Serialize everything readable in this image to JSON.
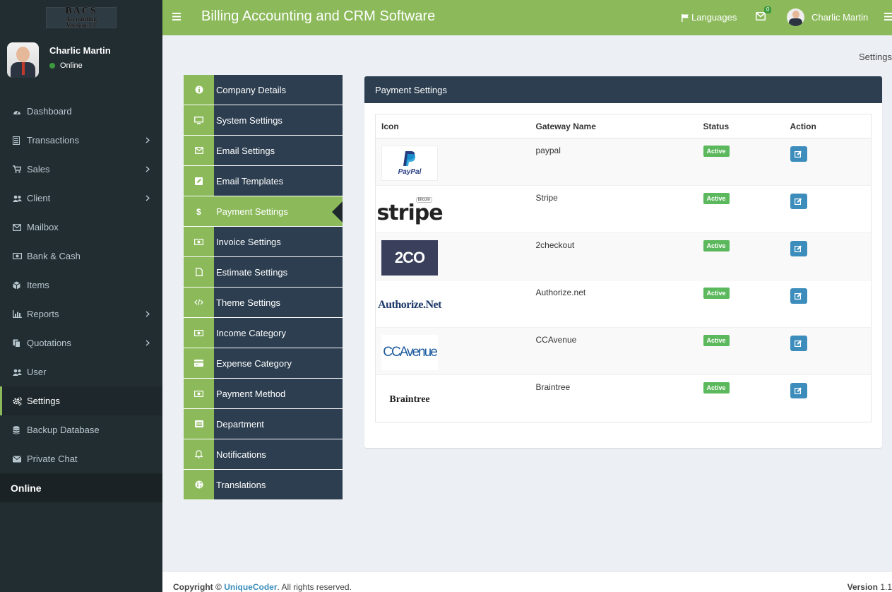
{
  "logo": {
    "line1": "BACS",
    "line2": "Accounting",
    "line3": "Version 1.1"
  },
  "user": {
    "name": "Charlic Martin",
    "status": "Online"
  },
  "sidebar": {
    "items": [
      {
        "label": "Dashboard",
        "icon": "dashboard-icon",
        "chevron": false
      },
      {
        "label": "Transactions",
        "icon": "transactions-icon",
        "chevron": true
      },
      {
        "label": "Sales",
        "icon": "cart-icon",
        "chevron": true
      },
      {
        "label": "Client",
        "icon": "users-icon",
        "chevron": true
      },
      {
        "label": "Mailbox",
        "icon": "mail-icon",
        "chevron": false
      },
      {
        "label": "Bank & Cash",
        "icon": "money-icon",
        "chevron": false
      },
      {
        "label": "Items",
        "icon": "cube-icon",
        "chevron": false
      },
      {
        "label": "Reports",
        "icon": "chart-icon",
        "chevron": true
      },
      {
        "label": "Quotations",
        "icon": "copy-icon",
        "chevron": true
      },
      {
        "label": "User",
        "icon": "users-icon",
        "chevron": false
      },
      {
        "label": "Settings",
        "icon": "gears-icon",
        "chevron": false,
        "active": true
      },
      {
        "label": "Backup Database",
        "icon": "database-icon",
        "chevron": false
      },
      {
        "label": "Private Chat",
        "icon": "envelope-icon",
        "chevron": false
      }
    ],
    "online_heading": "Online"
  },
  "header": {
    "title": "Billing Accounting and CRM Software",
    "languages": "Languages",
    "mail_count": "0",
    "user_name": "Charlic Martin"
  },
  "breadcrumb": "Settings",
  "settings_menu": [
    {
      "label": "Company Details",
      "icon": "info-icon"
    },
    {
      "label": "System Settings",
      "icon": "desktop-icon"
    },
    {
      "label": "Email Settings",
      "icon": "envelope-icon"
    },
    {
      "label": "Email Templates",
      "icon": "edit-icon"
    },
    {
      "label": "Payment Settings",
      "icon": "dollar-icon",
      "active": true
    },
    {
      "label": "Invoice Settings",
      "icon": "money-icon"
    },
    {
      "label": "Estimate Settings",
      "icon": "file-icon"
    },
    {
      "label": "Theme Settings",
      "icon": "code-icon"
    },
    {
      "label": "Income Category",
      "icon": "money-icon"
    },
    {
      "label": "Expense Category",
      "icon": "card-icon"
    },
    {
      "label": "Payment Method",
      "icon": "money-icon"
    },
    {
      "label": "Department",
      "icon": "list-icon"
    },
    {
      "label": "Notifications",
      "icon": "bell-icon"
    },
    {
      "label": "Translations",
      "icon": "globe-icon"
    }
  ],
  "payment_panel": {
    "title": "Payment Settings",
    "columns": [
      "Icon",
      "Gateway Name",
      "Status",
      "Action"
    ],
    "rows": [
      {
        "gateway": "paypal",
        "status": "Active",
        "logo_text": "PayPal",
        "logo": "paypal-logo"
      },
      {
        "gateway": "Stripe",
        "status": "Active",
        "logo_text": "stripe",
        "logo_sub": "bitcoin",
        "logo": "stripe-logo"
      },
      {
        "gateway": "2checkout",
        "status": "Active",
        "logo_text": "2CO",
        "logo": "2co-logo"
      },
      {
        "gateway": "Authorize.net",
        "status": "Active",
        "logo_text": "Authorize.Net",
        "logo": "authorizenet-logo"
      },
      {
        "gateway": "CCAvenue",
        "status": "Active",
        "logo_text": "CCAvenue",
        "logo": "ccavenue-logo"
      },
      {
        "gateway": "Braintree",
        "status": "Active",
        "logo_text": "Braintree",
        "logo": "braintree-logo"
      }
    ]
  },
  "footer": {
    "copyright_prefix": "Copyright ©",
    "company": "UniqueCoder",
    "suffix": ". All rights reserved.",
    "version_label": "Version",
    "version": "1.1"
  },
  "colors": {
    "accent": "#8cba5b",
    "sidebar": "#222d32",
    "panel_head": "#2c3e50",
    "badge": "#5cb85c",
    "button": "#3c8dbc"
  }
}
